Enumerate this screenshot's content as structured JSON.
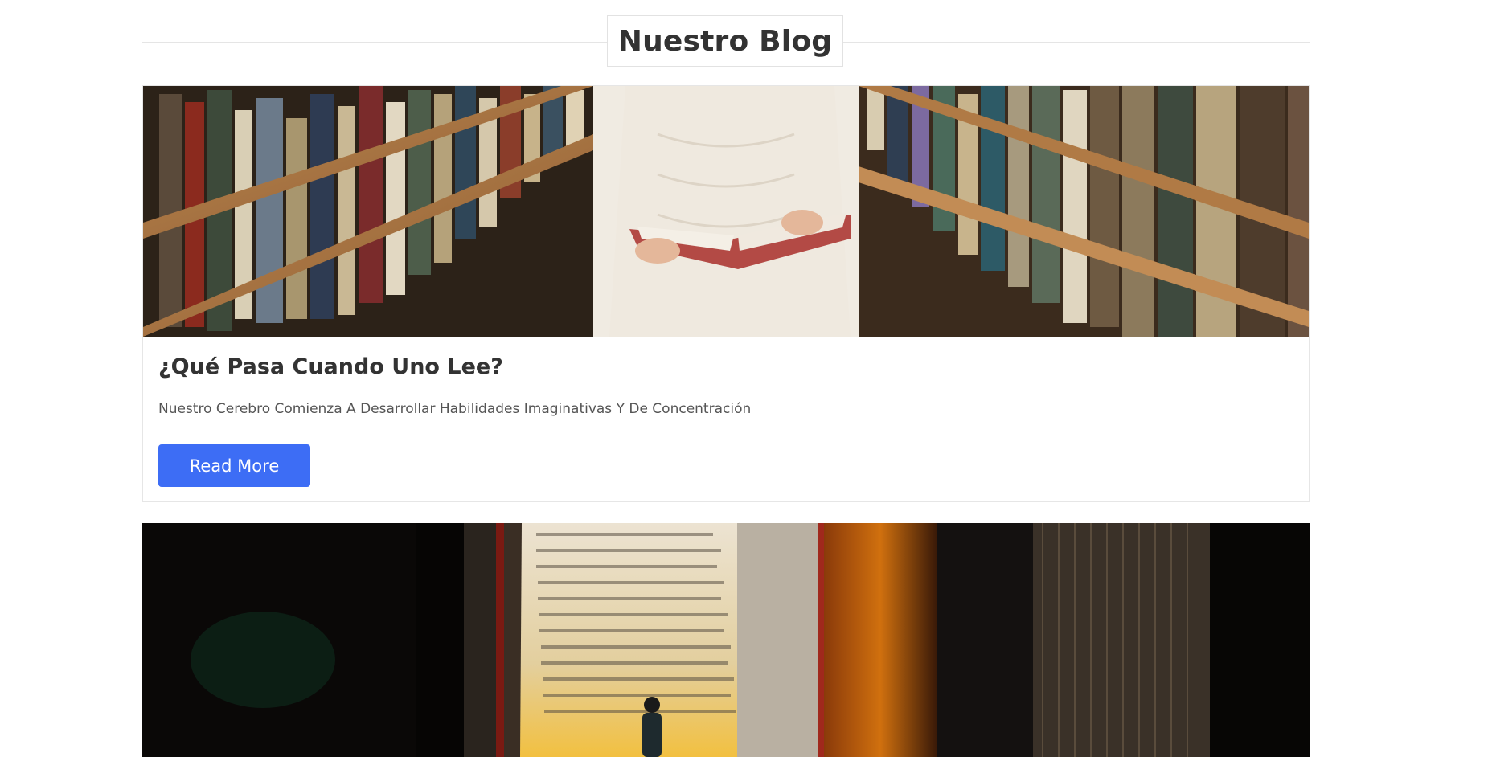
{
  "section": {
    "heading": "Nuestro Blog"
  },
  "posts": [
    {
      "title": "¿Qué Pasa Cuando Uno Lee?",
      "description": "Nuestro Cerebro Comienza A Desarrollar Habilidades Imaginativas Y De Concentración",
      "button_label": "Read More",
      "image": "library-reader-photo"
    },
    {
      "image": "giant-book-figure-photo"
    }
  ],
  "colors": {
    "button": "#3d6df5",
    "heading_text": "#333333",
    "border": "#e6e6e6"
  }
}
